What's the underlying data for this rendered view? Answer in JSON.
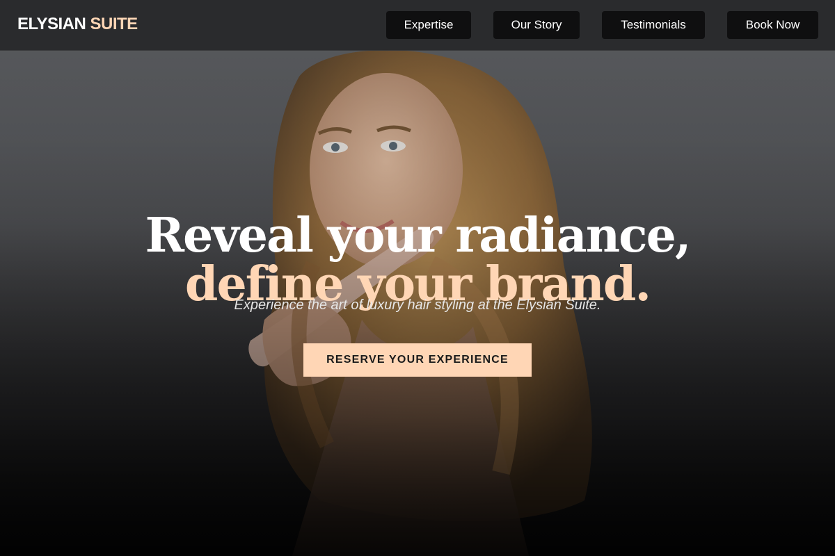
{
  "brand": {
    "name_main": "ELYSIAN",
    "name_accent": "SUITE",
    "accent_color": "#ffd6b5"
  },
  "nav": {
    "items": [
      {
        "label": "Expertise"
      },
      {
        "label": "Our Story"
      },
      {
        "label": "Testimonials"
      },
      {
        "label": "Book Now"
      }
    ]
  },
  "hero": {
    "headline_line1": "Reveal your radiance,",
    "headline_line2": "define your brand.",
    "subtitle": "Experience the art of luxury hair styling at the Elysian Suite.",
    "cta_label": "RESERVE YOUR EXPERIENCE"
  }
}
